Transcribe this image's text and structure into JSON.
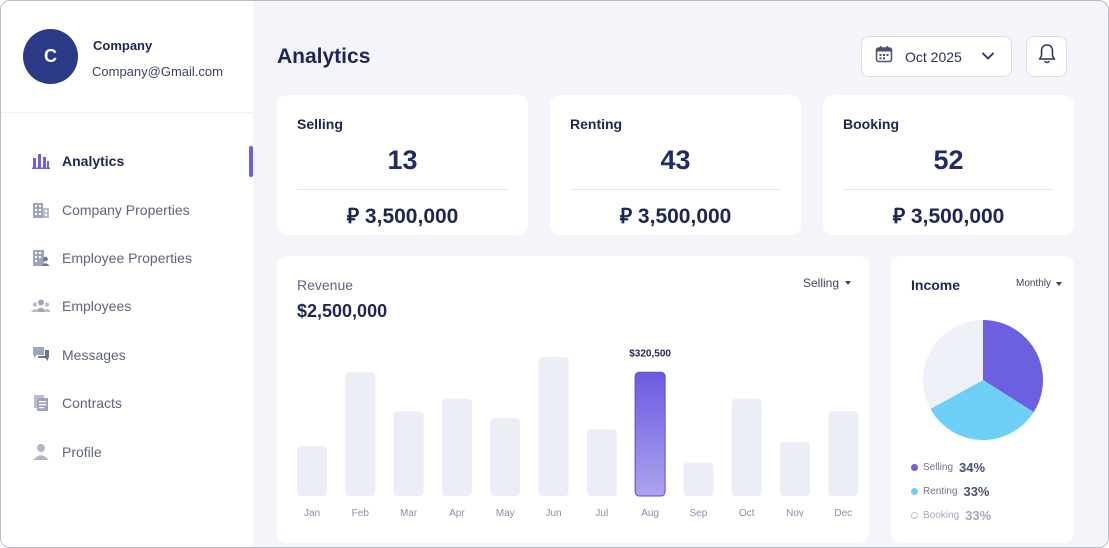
{
  "sidebar": {
    "profile": {
      "initial": "C",
      "name": "Company",
      "email": "Company@Gmail.com"
    },
    "items": [
      {
        "label": "Analytics",
        "icon": "bar-chart-icon",
        "active": true
      },
      {
        "label": "Company Properties",
        "icon": "building-icon"
      },
      {
        "label": "Employee Properties",
        "icon": "employee-building-icon"
      },
      {
        "label": "Employees",
        "icon": "people-icon"
      },
      {
        "label": "Messages",
        "icon": "chat-icon"
      },
      {
        "label": "Contracts",
        "icon": "document-icon"
      },
      {
        "label": "Profile",
        "icon": "user-icon"
      }
    ]
  },
  "header": {
    "title": "Analytics",
    "date_label": "Oct 2025",
    "calendar_icon": "calendar-icon",
    "bell_icon": "bell-icon"
  },
  "stats": [
    {
      "label": "Selling",
      "count": "13",
      "amount": "⃁ 3,500,000"
    },
    {
      "label": "Renting",
      "count": "43",
      "amount": "⃁ 3,500,000"
    },
    {
      "label": "Booking",
      "count": "52",
      "amount": "⃁ 3,500,000"
    }
  ],
  "revenue": {
    "title": "Revenue",
    "total": "$2,500,000",
    "filter": "Selling",
    "highlight_label": "$320,500"
  },
  "income": {
    "title": "Income",
    "filter": "Monthly",
    "legend": [
      {
        "name": "Selling",
        "value": "34%"
      },
      {
        "name": "Renting",
        "value": "33%"
      },
      {
        "name": "Booking",
        "value": "33%"
      }
    ]
  },
  "colors": {
    "accent": "#6c5fe0",
    "renting": "#6fd0f7",
    "booking": "#eef1f8",
    "bar": "#eceef6",
    "navy": "#1e2557"
  },
  "chart_data": [
    {
      "type": "bar",
      "title": "Revenue",
      "categories": [
        "Jan",
        "Feb",
        "Mar",
        "Apr",
        "May",
        "Jun",
        "Jul",
        "Aug",
        "Sep",
        "Oct",
        "Nov",
        "Dec"
      ],
      "values": [
        0.36,
        0.89,
        0.61,
        0.7,
        0.56,
        1.0,
        0.48,
        0.89,
        0.24,
        0.7,
        0.39,
        0.61
      ],
      "highlight_index": 7,
      "highlight_label": "$320,500"
    },
    {
      "type": "pie",
      "title": "Income",
      "labels": [
        "Selling",
        "Renting",
        "Booking"
      ],
      "values": [
        34,
        33,
        33
      ]
    }
  ]
}
